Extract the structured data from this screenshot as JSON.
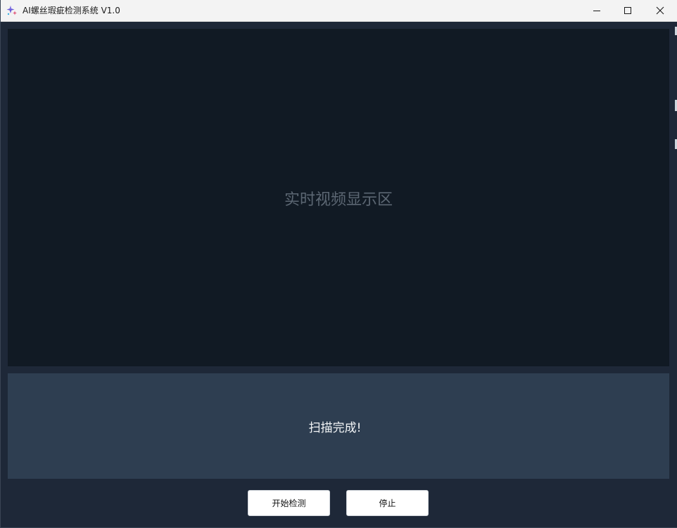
{
  "window": {
    "title": "AI螺丝瑕疵检测系统 V1.0",
    "icon": "sparkle-icon",
    "controls": {
      "minimize": "minimize-icon",
      "maximize": "maximize-icon",
      "close": "close-icon"
    }
  },
  "video": {
    "placeholder": "实时视频显示区"
  },
  "status": {
    "message": "扫描完成!"
  },
  "buttons": {
    "start_label": "开始检测",
    "stop_label": "停止"
  },
  "colors": {
    "video_bg": "#111a24",
    "status_bg": "#2e3e51",
    "window_bg": "#1e2838",
    "titlebar_bg": "#f3f3f3"
  }
}
